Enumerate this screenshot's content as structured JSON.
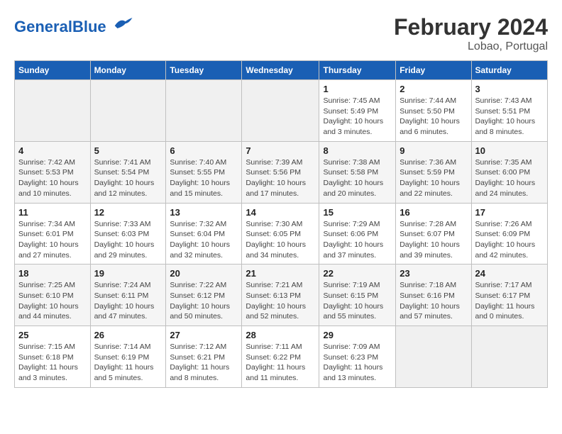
{
  "header": {
    "logo_text_general": "General",
    "logo_text_blue": "Blue",
    "month_year": "February 2024",
    "location": "Lobao, Portugal"
  },
  "days_of_week": [
    "Sunday",
    "Monday",
    "Tuesday",
    "Wednesday",
    "Thursday",
    "Friday",
    "Saturday"
  ],
  "weeks": [
    [
      {
        "day": "",
        "info": ""
      },
      {
        "day": "",
        "info": ""
      },
      {
        "day": "",
        "info": ""
      },
      {
        "day": "",
        "info": ""
      },
      {
        "day": "1",
        "info": "Sunrise: 7:45 AM\nSunset: 5:49 PM\nDaylight: 10 hours\nand 3 minutes."
      },
      {
        "day": "2",
        "info": "Sunrise: 7:44 AM\nSunset: 5:50 PM\nDaylight: 10 hours\nand 6 minutes."
      },
      {
        "day": "3",
        "info": "Sunrise: 7:43 AM\nSunset: 5:51 PM\nDaylight: 10 hours\nand 8 minutes."
      }
    ],
    [
      {
        "day": "4",
        "info": "Sunrise: 7:42 AM\nSunset: 5:53 PM\nDaylight: 10 hours\nand 10 minutes."
      },
      {
        "day": "5",
        "info": "Sunrise: 7:41 AM\nSunset: 5:54 PM\nDaylight: 10 hours\nand 12 minutes."
      },
      {
        "day": "6",
        "info": "Sunrise: 7:40 AM\nSunset: 5:55 PM\nDaylight: 10 hours\nand 15 minutes."
      },
      {
        "day": "7",
        "info": "Sunrise: 7:39 AM\nSunset: 5:56 PM\nDaylight: 10 hours\nand 17 minutes."
      },
      {
        "day": "8",
        "info": "Sunrise: 7:38 AM\nSunset: 5:58 PM\nDaylight: 10 hours\nand 20 minutes."
      },
      {
        "day": "9",
        "info": "Sunrise: 7:36 AM\nSunset: 5:59 PM\nDaylight: 10 hours\nand 22 minutes."
      },
      {
        "day": "10",
        "info": "Sunrise: 7:35 AM\nSunset: 6:00 PM\nDaylight: 10 hours\nand 24 minutes."
      }
    ],
    [
      {
        "day": "11",
        "info": "Sunrise: 7:34 AM\nSunset: 6:01 PM\nDaylight: 10 hours\nand 27 minutes."
      },
      {
        "day": "12",
        "info": "Sunrise: 7:33 AM\nSunset: 6:03 PM\nDaylight: 10 hours\nand 29 minutes."
      },
      {
        "day": "13",
        "info": "Sunrise: 7:32 AM\nSunset: 6:04 PM\nDaylight: 10 hours\nand 32 minutes."
      },
      {
        "day": "14",
        "info": "Sunrise: 7:30 AM\nSunset: 6:05 PM\nDaylight: 10 hours\nand 34 minutes."
      },
      {
        "day": "15",
        "info": "Sunrise: 7:29 AM\nSunset: 6:06 PM\nDaylight: 10 hours\nand 37 minutes."
      },
      {
        "day": "16",
        "info": "Sunrise: 7:28 AM\nSunset: 6:07 PM\nDaylight: 10 hours\nand 39 minutes."
      },
      {
        "day": "17",
        "info": "Sunrise: 7:26 AM\nSunset: 6:09 PM\nDaylight: 10 hours\nand 42 minutes."
      }
    ],
    [
      {
        "day": "18",
        "info": "Sunrise: 7:25 AM\nSunset: 6:10 PM\nDaylight: 10 hours\nand 44 minutes."
      },
      {
        "day": "19",
        "info": "Sunrise: 7:24 AM\nSunset: 6:11 PM\nDaylight: 10 hours\nand 47 minutes."
      },
      {
        "day": "20",
        "info": "Sunrise: 7:22 AM\nSunset: 6:12 PM\nDaylight: 10 hours\nand 50 minutes."
      },
      {
        "day": "21",
        "info": "Sunrise: 7:21 AM\nSunset: 6:13 PM\nDaylight: 10 hours\nand 52 minutes."
      },
      {
        "day": "22",
        "info": "Sunrise: 7:19 AM\nSunset: 6:15 PM\nDaylight: 10 hours\nand 55 minutes."
      },
      {
        "day": "23",
        "info": "Sunrise: 7:18 AM\nSunset: 6:16 PM\nDaylight: 10 hours\nand 57 minutes."
      },
      {
        "day": "24",
        "info": "Sunrise: 7:17 AM\nSunset: 6:17 PM\nDaylight: 11 hours\nand 0 minutes."
      }
    ],
    [
      {
        "day": "25",
        "info": "Sunrise: 7:15 AM\nSunset: 6:18 PM\nDaylight: 11 hours\nand 3 minutes."
      },
      {
        "day": "26",
        "info": "Sunrise: 7:14 AM\nSunset: 6:19 PM\nDaylight: 11 hours\nand 5 minutes."
      },
      {
        "day": "27",
        "info": "Sunrise: 7:12 AM\nSunset: 6:21 PM\nDaylight: 11 hours\nand 8 minutes."
      },
      {
        "day": "28",
        "info": "Sunrise: 7:11 AM\nSunset: 6:22 PM\nDaylight: 11 hours\nand 11 minutes."
      },
      {
        "day": "29",
        "info": "Sunrise: 7:09 AM\nSunset: 6:23 PM\nDaylight: 11 hours\nand 13 minutes."
      },
      {
        "day": "",
        "info": ""
      },
      {
        "day": "",
        "info": ""
      }
    ]
  ]
}
